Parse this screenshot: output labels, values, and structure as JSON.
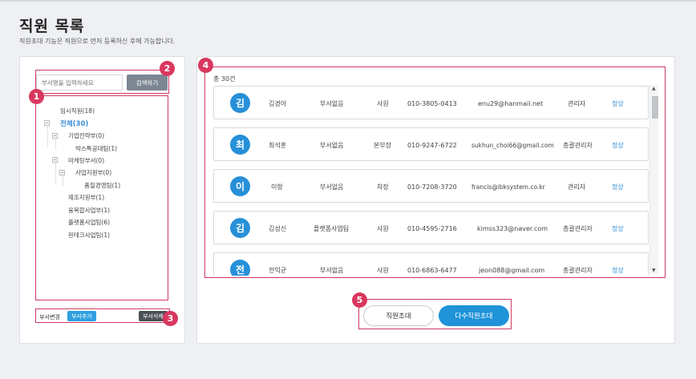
{
  "page": {
    "title": "직원 목록",
    "subtitle": "직원초대 기능은 직원으로 먼저 등록하신 후에 가능합니다."
  },
  "search": {
    "placeholder": "부서명을 입력하세요",
    "button_label": "검색하기"
  },
  "tree": {
    "items": [
      {
        "label": "임시직원(18)"
      },
      {
        "label": "전체(30)"
      },
      {
        "label": "기업전략부(0)"
      },
      {
        "label": "박스특공대팀(1)"
      },
      {
        "label": "마케팅부서(0)"
      },
      {
        "label": "사업지원부(0)"
      },
      {
        "label": "품질경영팀(1)"
      },
      {
        "label": "제조지원부(1)"
      },
      {
        "label": "융복합사업부(1)"
      },
      {
        "label": "플랫폼사업팀(6)"
      },
      {
        "label": "핀테크사업팀(1)"
      }
    ]
  },
  "dept_buttons": {
    "change": "부서변경",
    "add": "부서추가",
    "delete": "부서삭제"
  },
  "badges": [
    "1",
    "2",
    "3",
    "4",
    "5"
  ],
  "list": {
    "total": "총 30건",
    "employees": [
      {
        "initial": "김",
        "name": "김경아",
        "dept": "부서없음",
        "position": "사원",
        "phone": "010-3805-0413",
        "email": "enu29@hanmail.net",
        "role": "관리자",
        "status": "정상"
      },
      {
        "initial": "최",
        "name": "최석훈",
        "dept": "부서없음",
        "position": "본부장",
        "phone": "010-9247-6722",
        "email": "sukhun_choi66@gmail.com",
        "role": "총괄관리자",
        "status": "정상"
      },
      {
        "initial": "이",
        "name": "이항",
        "dept": "부서없음",
        "position": "차장",
        "phone": "010-7208-3720",
        "email": "francis@ibksystem.co.kr",
        "role": "관리자",
        "status": "정상"
      },
      {
        "initial": "김",
        "name": "김성신",
        "dept": "플랫폼사업팀",
        "position": "사원",
        "phone": "010-4595-2716",
        "email": "kimss323@naver.com",
        "role": "총괄관리자",
        "status": "정상"
      },
      {
        "initial": "전",
        "name": "전익균",
        "dept": "부서없음",
        "position": "사원",
        "phone": "010-6863-6477",
        "email": "jeon088@gmail.com",
        "role": "총괄관리자",
        "status": "정상"
      }
    ]
  },
  "actions": {
    "invite": "직원초대",
    "multi_invite": "다수직원초대"
  },
  "colors": {
    "accent": "#2790d8",
    "highlight": "#d9375f",
    "selected_tree": "#3b8fd6"
  }
}
